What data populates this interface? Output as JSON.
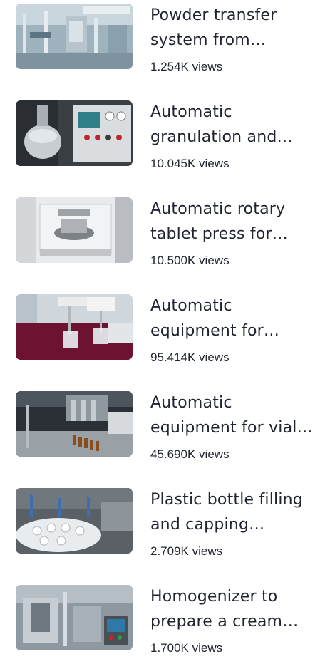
{
  "videos": [
    {
      "title": "Powder transfer system from stainless steel",
      "views": "1.254K views",
      "thumb_icon": "powder-transfer-machine-thumbnail"
    },
    {
      "title": "Automatic granulation and drying machine",
      "views": "10.045K views",
      "thumb_icon": "granulation-machine-thumbnail"
    },
    {
      "title": "Automatic rotary tablet press for pharmacy",
      "views": "10.500K views",
      "thumb_icon": "tablet-press-thumbnail"
    },
    {
      "title": "Automatic equipment for dissolution testing",
      "views": "95.414K views",
      "thumb_icon": "dissolution-tester-thumbnail"
    },
    {
      "title": "Automatic equipment for vial filling",
      "views": "45.690K views",
      "thumb_icon": "vial-filling-thumbnail"
    },
    {
      "title": "Plastic bottle filling and capping machine",
      "views": "2.709K views",
      "thumb_icon": "bottle-capping-thumbnail"
    },
    {
      "title": "Homogenizer to prepare a cream ointment",
      "views": "1.700K views",
      "thumb_icon": "homogenizer-thumbnail"
    }
  ]
}
